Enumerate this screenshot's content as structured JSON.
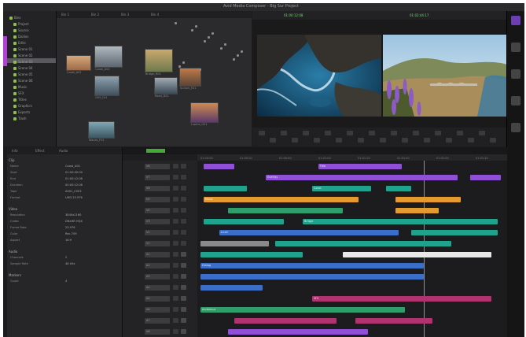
{
  "app": {
    "window_title": "Avid Media Composer - Big Sur Project"
  },
  "colors": {
    "accent_purple": "#b43fd6",
    "timecode_green": "#7fd27a",
    "clip_purple": "#8f4fd6",
    "clip_blue": "#3a6ec9",
    "clip_teal": "#1fa38d",
    "clip_orange": "#e59a2f",
    "clip_pink": "#b0326f",
    "clip_green": "#2f9e6b",
    "clip_gray": "#8a8a8a",
    "clip_white": "#e8e8e8"
  },
  "bins": {
    "items": [
      "Bins",
      "Project",
      "Source",
      "Dailies",
      "Edits",
      "Scene 01",
      "Scene 02",
      "Scene 03",
      "Scene 04",
      "Scene 05",
      "Scene 06",
      "Music",
      "SFX",
      "Titles",
      "Graphics",
      "Exports",
      "Trash"
    ]
  },
  "thumbnails": {
    "tabs": [
      "Bin 1",
      "Bin 2",
      "Bin 3",
      "Bin 4"
    ],
    "items": [
      {
        "name": "Coast_A01",
        "icon": "landscape-thumb"
      },
      {
        "name": "Coast_A02",
        "icon": "landscape-thumb"
      },
      {
        "name": "Bridge_B01",
        "icon": "landscape-thumb"
      },
      {
        "name": "Cliff_C01",
        "icon": "landscape-thumb"
      },
      {
        "name": "Road_D01",
        "icon": "landscape-thumb"
      },
      {
        "name": "Sunset_E01",
        "icon": "landscape-thumb"
      },
      {
        "name": "Waves_F01",
        "icon": "landscape-thumb"
      },
      {
        "name": "Lupine_G01",
        "icon": "landscape-thumb"
      }
    ]
  },
  "viewer": {
    "source_tc": "01:00:12:08",
    "record_tc": "01:02:44:17"
  },
  "inspector": {
    "tabs": [
      "Info",
      "Effect",
      "Audio"
    ],
    "sections": [
      {
        "title": "Clip",
        "rows": [
          [
            "Name",
            "Coast_A01"
          ],
          [
            "Start",
            "01:00:00:00"
          ],
          [
            "End",
            "01:00:12:08"
          ],
          [
            "Duration",
            "00:00:12:08"
          ],
          [
            "Tape",
            "A001_C003"
          ],
          [
            "Format",
            "UHD 23.976"
          ]
        ]
      },
      {
        "title": "Video",
        "rows": [
          [
            "Resolution",
            "3840x2160"
          ],
          [
            "Codec",
            "DNxHR HQX"
          ],
          [
            "Frame Rate",
            "23.976"
          ],
          [
            "Color",
            "Rec.709"
          ],
          [
            "Aspect",
            "16:9"
          ]
        ]
      },
      {
        "title": "Audio",
        "rows": [
          [
            "Channels",
            "2"
          ],
          [
            "Sample Rate",
            "48 kHz"
          ]
        ]
      },
      {
        "title": "Markers",
        "rows": [
          [
            "Count",
            "4"
          ]
        ]
      }
    ]
  },
  "timeline": {
    "ruler": [
      "01:00:00",
      "01:00:20",
      "01:00:40",
      "01:01:00",
      "01:01:20",
      "01:01:40",
      "01:02:00",
      "01:02:20"
    ],
    "tracks": [
      "V8",
      "V7",
      "V6",
      "V5",
      "V4",
      "V3",
      "V2",
      "V1",
      "A1",
      "A2",
      "A3",
      "A4",
      "A5",
      "A6",
      "A7",
      "A8"
    ],
    "clips": [
      {
        "track": 0,
        "start": 0.02,
        "len": 0.1,
        "color": "#8f4fd6",
        "label": ""
      },
      {
        "track": 0,
        "start": 0.39,
        "len": 0.27,
        "color": "#8f4fd6",
        "label": "Title"
      },
      {
        "track": 1,
        "start": 0.22,
        "len": 0.62,
        "color": "#8f4fd6",
        "label": "Overlay"
      },
      {
        "track": 1,
        "start": 0.88,
        "len": 0.1,
        "color": "#8f4fd6",
        "label": ""
      },
      {
        "track": 2,
        "start": 0.02,
        "len": 0.14,
        "color": "#1fa38d",
        "label": ""
      },
      {
        "track": 2,
        "start": 0.37,
        "len": 0.19,
        "color": "#1fa38d",
        "label": "Coast"
      },
      {
        "track": 2,
        "start": 0.61,
        "len": 0.08,
        "color": "#1fa38d",
        "label": ""
      },
      {
        "track": 3,
        "start": 0.02,
        "len": 0.5,
        "color": "#e59a2f",
        "label": "Music"
      },
      {
        "track": 3,
        "start": 0.64,
        "len": 0.21,
        "color": "#e59a2f",
        "label": ""
      },
      {
        "track": 4,
        "start": 0.1,
        "len": 0.37,
        "color": "#2f9e6b",
        "label": ""
      },
      {
        "track": 4,
        "start": 0.64,
        "len": 0.14,
        "color": "#e59a2f",
        "label": ""
      },
      {
        "track": 5,
        "start": 0.02,
        "len": 0.26,
        "color": "#1fa38d",
        "label": ""
      },
      {
        "track": 5,
        "start": 0.34,
        "len": 0.63,
        "color": "#1fa38d",
        "label": "Bridge"
      },
      {
        "track": 6,
        "start": 0.07,
        "len": 0.58,
        "color": "#3a6ec9",
        "label": "A-roll"
      },
      {
        "track": 6,
        "start": 0.69,
        "len": 0.28,
        "color": "#1fa38d",
        "label": ""
      },
      {
        "track": 7,
        "start": 0.01,
        "len": 0.22,
        "color": "#8a8a8a",
        "label": ""
      },
      {
        "track": 7,
        "start": 0.25,
        "len": 0.57,
        "color": "#1fa38d",
        "label": ""
      },
      {
        "track": 8,
        "start": 0.01,
        "len": 0.33,
        "color": "#1fa38d",
        "label": ""
      },
      {
        "track": 8,
        "start": 0.47,
        "len": 0.48,
        "color": "#e8e8e8",
        "label": ""
      },
      {
        "track": 9,
        "start": 0.01,
        "len": 0.72,
        "color": "#3a6ec9",
        "label": "Dialog"
      },
      {
        "track": 10,
        "start": 0.01,
        "len": 0.72,
        "color": "#3a6ec9",
        "label": ""
      },
      {
        "track": 11,
        "start": 0.01,
        "len": 0.2,
        "color": "#3a6ec9",
        "label": ""
      },
      {
        "track": 12,
        "start": 0.37,
        "len": 0.58,
        "color": "#b0326f",
        "label": "SFX"
      },
      {
        "track": 13,
        "start": 0.01,
        "len": 0.66,
        "color": "#2f9e6b",
        "label": "Ambience"
      },
      {
        "track": 14,
        "start": 0.12,
        "len": 0.33,
        "color": "#b0326f",
        "label": ""
      },
      {
        "track": 14,
        "start": 0.51,
        "len": 0.25,
        "color": "#b0326f",
        "label": ""
      },
      {
        "track": 15,
        "start": 0.1,
        "len": 0.45,
        "color": "#8f4fd6",
        "label": ""
      }
    ]
  }
}
